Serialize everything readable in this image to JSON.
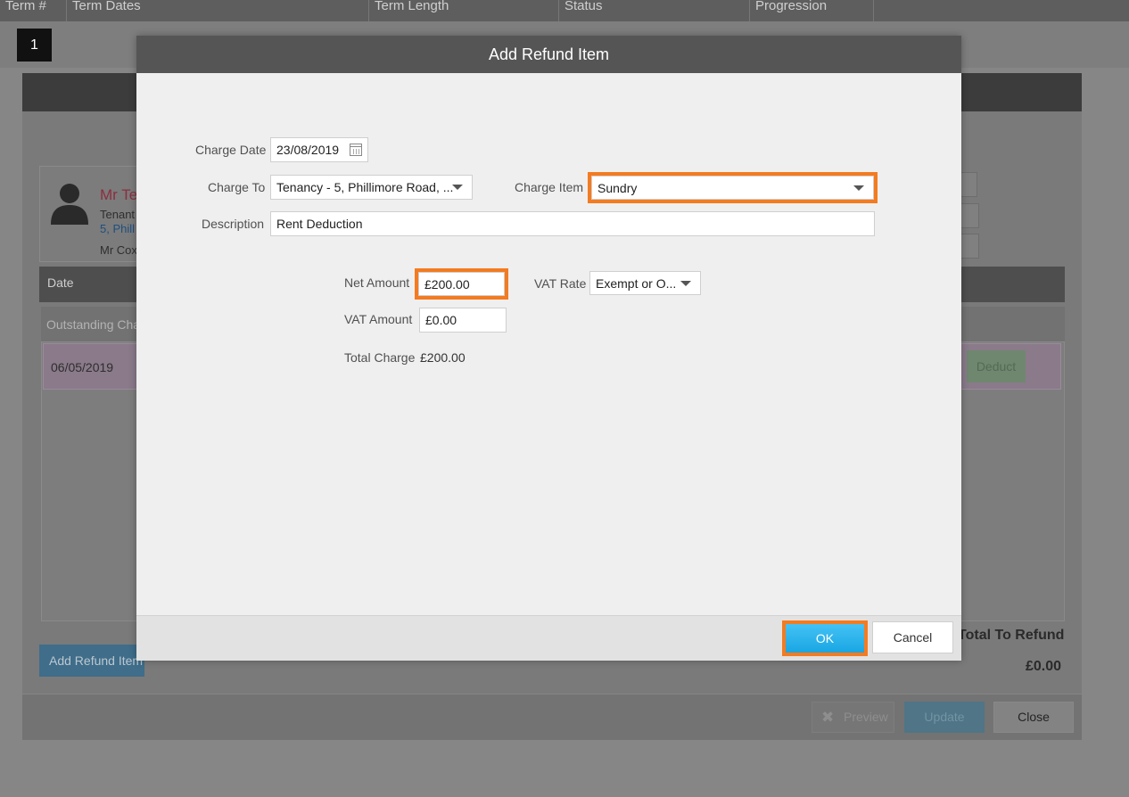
{
  "background_table": {
    "columns": [
      "Term #",
      "Term Dates",
      "Term Length",
      "Status",
      "Progression"
    ],
    "term_number": "1"
  },
  "background_window": {
    "tenant": {
      "name": "Mr Te",
      "role": "Tenant",
      "address": "5, Phill",
      "contact": "Mr Cox"
    },
    "grid_header": "Date",
    "section_label": "Outstanding Cha",
    "row_date": "06/05/2019",
    "deduct_label": "Deduct",
    "add_refund_label": "Add Refund Item",
    "total_refund_label": "Total To Refund",
    "total_refund_value": "£0.00",
    "footer": {
      "preview_label": "Preview",
      "update_label": "Update",
      "close_label": "Close"
    }
  },
  "modal": {
    "title": "Add Refund Item",
    "charge_date": {
      "label": "Charge Date",
      "value": "23/08/2019"
    },
    "charge_to": {
      "label": "Charge To",
      "value": "Tenancy - 5, Phillimore Road, ..."
    },
    "charge_item": {
      "label": "Charge Item",
      "value": "Sundry"
    },
    "description": {
      "label": "Description",
      "value": "Rent Deduction"
    },
    "net_amount": {
      "label": "Net Amount",
      "value": "£200.00"
    },
    "vat_rate": {
      "label": "VAT Rate",
      "value": "Exempt or O..."
    },
    "vat_amount": {
      "label": "VAT Amount",
      "value": "£0.00"
    },
    "total_charge": {
      "label": "Total Charge",
      "value": "£200.00"
    },
    "ok_label": "OK",
    "cancel_label": "Cancel"
  },
  "colors": {
    "highlight": "#f47b20",
    "ok_button": "#19a6e3",
    "modal_header": "#555555"
  }
}
